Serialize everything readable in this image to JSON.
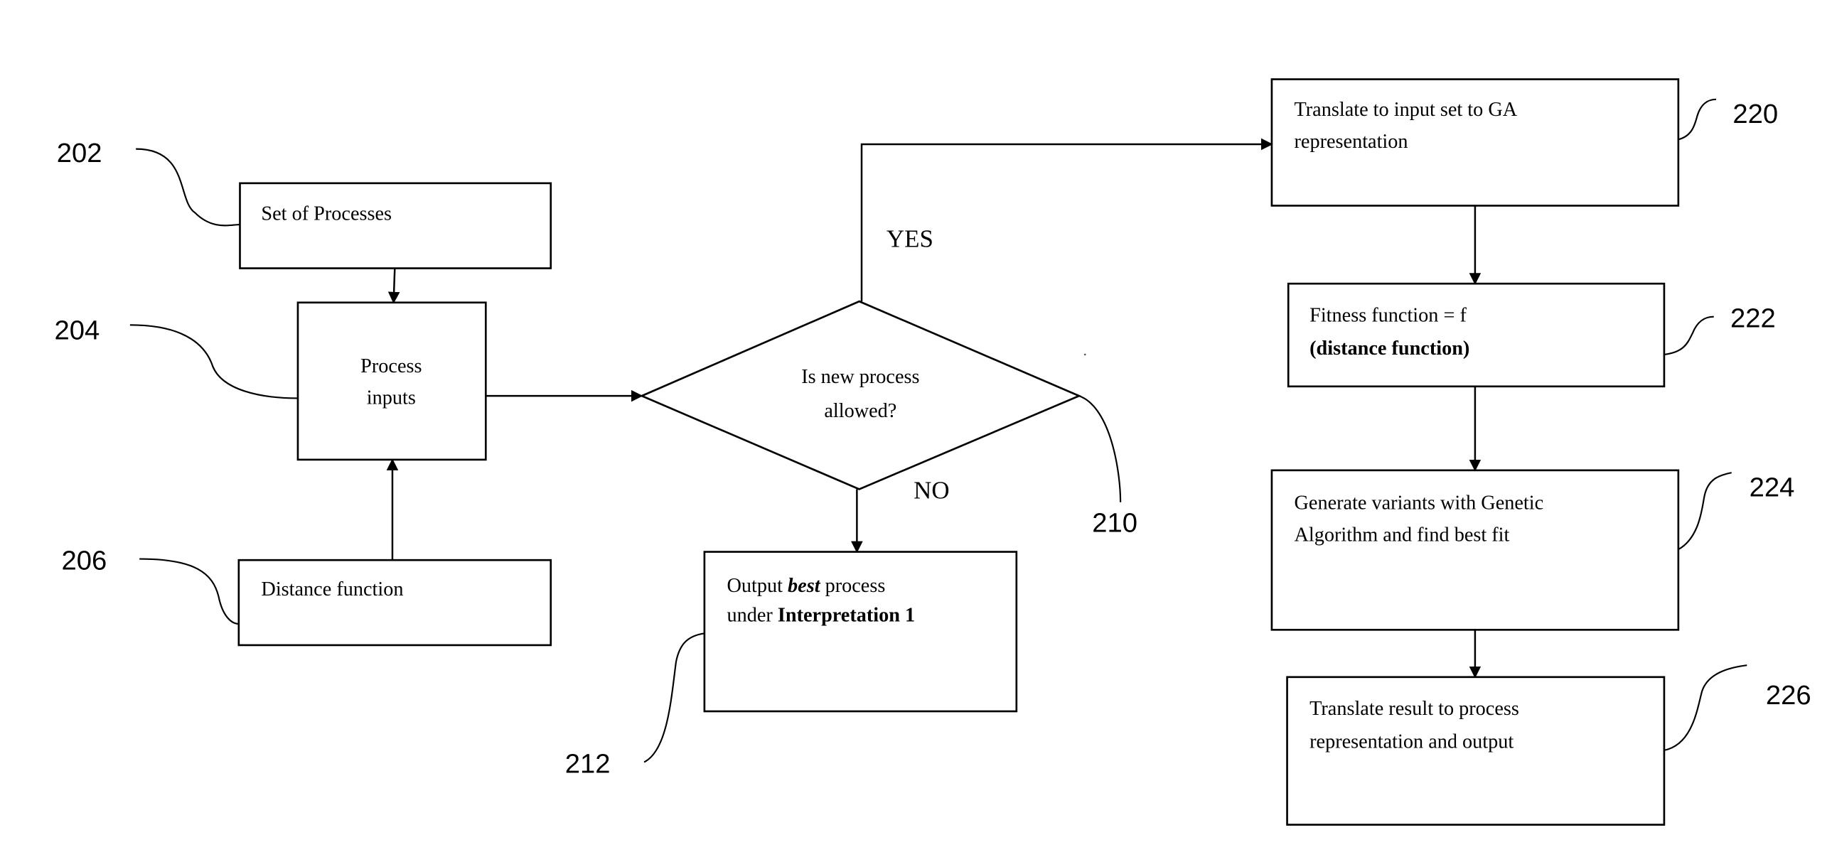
{
  "diagram": {
    "type": "flowchart",
    "nodes": {
      "n202": {
        "ref": "202",
        "lines": [
          "Set of Processes"
        ]
      },
      "n204": {
        "ref": "204",
        "lines": [
          "Process",
          "inputs"
        ]
      },
      "n206": {
        "ref": "206",
        "lines": [
          "Distance function"
        ]
      },
      "n210": {
        "ref": "210",
        "lines": [
          "Is new process",
          "allowed?"
        ]
      },
      "n212": {
        "ref": "212",
        "line1_a": "Output ",
        "line1_b": "best",
        "line1_c": " process",
        "line2_a": "under ",
        "line2_b": "Interpretation 1"
      },
      "n220": {
        "ref": "220",
        "lines": [
          "Translate to input set to GA",
          "representation"
        ]
      },
      "n222": {
        "ref": "222",
        "lines": [
          "Fitness function = f",
          "(distance function)"
        ]
      },
      "n224": {
        "ref": "224",
        "lines": [
          "Generate variants with Genetic",
          "Algorithm and find best fit"
        ]
      },
      "n226": {
        "ref": "226",
        "lines": [
          "Translate result to process",
          "representation and output"
        ]
      }
    },
    "branch_labels": {
      "yes": "YES",
      "no": "NO"
    },
    "edges": [
      {
        "from": "202",
        "to": "204"
      },
      {
        "from": "206",
        "to": "204"
      },
      {
        "from": "204",
        "to": "210"
      },
      {
        "from": "210",
        "to": "220",
        "label": "YES"
      },
      {
        "from": "210",
        "to": "212",
        "label": "NO"
      },
      {
        "from": "220",
        "to": "222"
      },
      {
        "from": "222",
        "to": "224"
      },
      {
        "from": "224",
        "to": "226"
      }
    ]
  }
}
